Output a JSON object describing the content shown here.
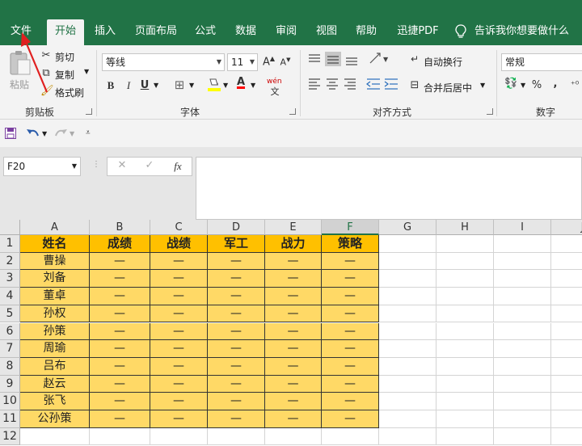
{
  "ribbon_tabs": [
    "文件",
    "开始",
    "插入",
    "页面布局",
    "公式",
    "数据",
    "审阅",
    "视图",
    "帮助",
    "迅捷PDF"
  ],
  "tell_me": "告诉我你想要做什么",
  "clipboard": {
    "paste": "粘贴",
    "cut": "剪切",
    "copy": "复制",
    "format_painter": "格式刷",
    "group_label": "剪贴板"
  },
  "font": {
    "name": "等线",
    "size": "11",
    "grow": "A",
    "shrink": "A",
    "bold": "B",
    "italic": "I",
    "underline": "U",
    "font_color_letter": "A",
    "phonetic": "wén",
    "group_label": "字体"
  },
  "alignment": {
    "wrap_text": "自动换行",
    "merge_center": "合并后居中",
    "group_label": "对齐方式"
  },
  "number": {
    "format": "常规",
    "percent": "%",
    "comma": ",",
    "group_label": "数字"
  },
  "formula_bar": {
    "name_box": "F20",
    "cancel": "✕",
    "enter": "✓",
    "fx": "fx",
    "formula": ""
  },
  "sheet": {
    "columns": [
      "A",
      "B",
      "C",
      "D",
      "E",
      "F",
      "G",
      "H",
      "I",
      "J"
    ],
    "rows": [
      "1",
      "2",
      "3",
      "4",
      "5",
      "6",
      "7",
      "8",
      "9",
      "10",
      "11",
      "12"
    ],
    "header": [
      "姓名",
      "成绩",
      "战绩",
      "军工",
      "战力",
      "策略"
    ],
    "names": [
      "曹操",
      "刘备",
      "董卓",
      "孙权",
      "孙策",
      "周瑜",
      "吕布",
      "赵云",
      "张飞",
      "公孙策"
    ],
    "dash": "—"
  },
  "colors": {
    "ribbon_green": "#217346",
    "header_fill": "#ffc000",
    "body_fill": "#ffd966",
    "arrow_red": "#e02020"
  }
}
